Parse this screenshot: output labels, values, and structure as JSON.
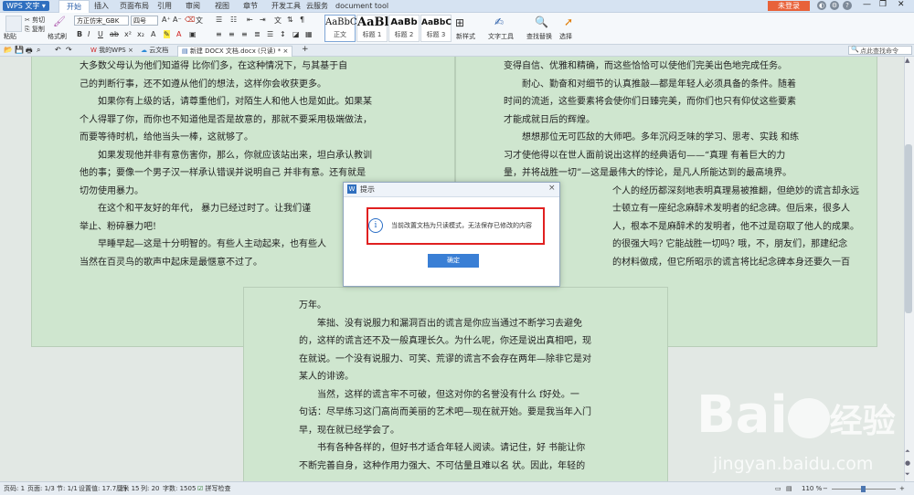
{
  "titlebar": {
    "app": "WPS 文字",
    "tabs": [
      "开始",
      "插入",
      "页面布局",
      "引用",
      "审阅",
      "视图",
      "章节",
      "开发工具",
      "云服务",
      "document tool"
    ],
    "login": "未登录"
  },
  "toolbar": {
    "paste": "粘贴",
    "cut": "剪切",
    "copy": "复制",
    "format_painter": "格式刷",
    "font": "方正仿宋_GBK",
    "size": "四号",
    "styles": [
      {
        "sample": "AaBbC",
        "label": "正文"
      },
      {
        "sample": "AaBl",
        "label": "标题 1"
      },
      {
        "sample": "AaBb",
        "label": "标题 2"
      },
      {
        "sample": "AaBbC",
        "label": "标题 3"
      }
    ],
    "new_style": "新样式",
    "text_tools": "文字工具",
    "find_replace": "查找替换",
    "select": "选择"
  },
  "doctabs": {
    "my_wps": "我的WPS",
    "cloud_doc": "云文档",
    "current": "新建 DOCX 文档.docx (只读) *",
    "help_search": "点此查找命令"
  },
  "doc": {
    "left_page": [
      "大多数父母认为他们知道得 比你们多，在这种情况下，与其基于自",
      "己的判断行事，还不如遵从他们的想法，这样你会收获更多。",
      "　　如果你有上级的话，请尊重他们，对陌生人和他人也是如此。如果某",
      "个人得罪了你，而你也不知道他是否是故意的，那就不要采用极端做法，",
      "而要等待时机，给他当头一棒，这就够了。",
      "　　如果发现他并非有意伤害你，那么，你就应该站出来，坦白承认教训",
      "他的事；要像一个男子汉一样承认错误并说明自己 并非有意。还有就是",
      "切勿使用暴力。",
      "　　在这个和平友好的年代， 暴力已经过时了。让我们谨",
      "举止、粉碎暴力吧!",
      "　　早睡早起—这是十分明智的。有些人主动起来，也有些人",
      "当然在百灵鸟的歌声中起床是最惬意不过了。"
    ],
    "right_page": [
      "变得自信、优雅和精确，而这些恰恰可以使他们完美出色地完成任务。",
      "　　耐心、勤奋和对细节的认真推敲—都是年轻人必须具备的条件。随着",
      "时间的流逝，这些要素将会使你们日臻完美，而你们也只有仰仗这些要素",
      "才能成就日后的辉煌。",
      "　　想想那位无可匹敌的大师吧。多年沉闷乏味的学习、思考、实践 和练",
      "习才使他得以在世人面前说出这样的经典语句——“真理 有着巨大的力",
      "量，并将战胜一切”—这是最伟大的悖论，是凡人所能达到的最高境界。",
      "个人的经历都深刻地表明真理易被推翻，但绝妙的谎言却永远",
      "士顿立有一座纪念麻醉术发明者的纪念碑。但后来，很多人",
      "人，根本不是麻醉术的发明者，他不过是窃取了他人的成果。",
      "的很强大吗? 它能战胜一切吗? 哦，不，朋友们，那建纪念",
      "的材料做成，但它所昭示的谎言将比纪念碑本身还要久一百"
    ],
    "bottom_page": [
      "万年。",
      "　　笨拙、没有说服力和漏洞百出的谎言是你应当通过不断学习去避免",
      "的，这样的谎言还不及一般真理长久。为什么呢，你还是说出真相吧，现",
      "在就说。一个没有说服力、可笑、荒谬的谎言不会存在两年—除非它是对",
      "某人的诽谤。",
      "　　当然，这样的谎言牢不可破，但这对你的名誉没有什么 f好处。一",
      "句话：尽早练习这门高尚而美丽的艺术吧—现在就开始。要是我当年入门",
      "早，现在就已经学会了。",
      "　　书有各种各样的，但好书才适合年轻人阅读。请记住，好 书能让你",
      "不断完善自身，这种作用力强大、不可估量且难以名 状。因此，年轻的"
    ]
  },
  "dialog": {
    "title": "提示",
    "message": "当前改置文档为只读模式，无法保存已修改的内容",
    "ok": "确定"
  },
  "statusbar": {
    "page_no": "页码: 1",
    "pages": "页面: 1/3",
    "section": "节: 1/1",
    "position": "设置值: 17.7厘米",
    "row": "行: 15",
    "col": "列: 20",
    "word_count": "字数: 1505",
    "spell_check": "拼写检查",
    "zoom": "110 %"
  },
  "watermark": {
    "brand": "Bai",
    "brand2": "经验",
    "url": "jingyan.baidu.com"
  }
}
